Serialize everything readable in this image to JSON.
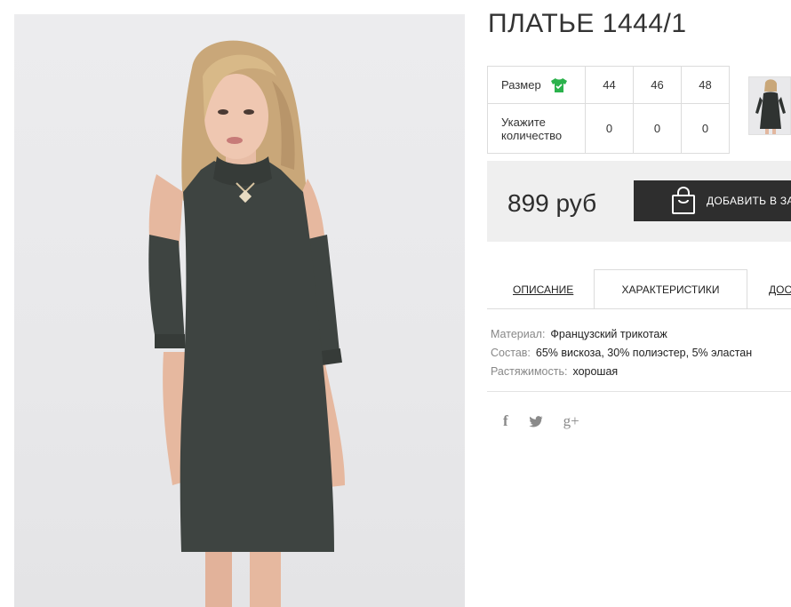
{
  "product": {
    "title": "ПЛАТЬЕ 1444/1",
    "price": "899 руб"
  },
  "size_table": {
    "size_label": "Размер",
    "qty_label": "Укажите количество",
    "sizes": [
      "44",
      "46",
      "48"
    ],
    "quantities": [
      "0",
      "0",
      "0"
    ],
    "size_icon": "tshirt-icon",
    "size_icon_color": "#2bb24c"
  },
  "buy": {
    "add_label": "ДОБАВИТЬ В ЗА",
    "cart_icon": "shopping-bag-icon"
  },
  "tabs": [
    {
      "label": "ОПИСАНИЕ"
    },
    {
      "label": "ХАРАКТЕРИСТИКИ"
    },
    {
      "label": "ДОС"
    }
  ],
  "specs": [
    {
      "key": "Материал:",
      "value": "Французский трикотаж"
    },
    {
      "key": "Состав:",
      "value": "65% вискоза, 30% полиэстер, 5% эластан"
    },
    {
      "key": "Растяжимость:",
      "value": "хорошая"
    }
  ],
  "social": {
    "facebook": "f",
    "twitter": "🐦",
    "googleplus": "g+"
  },
  "colors": {
    "button_bg": "#2e2e2e",
    "buybox_bg": "#efefef",
    "dress": "#3e4441"
  }
}
